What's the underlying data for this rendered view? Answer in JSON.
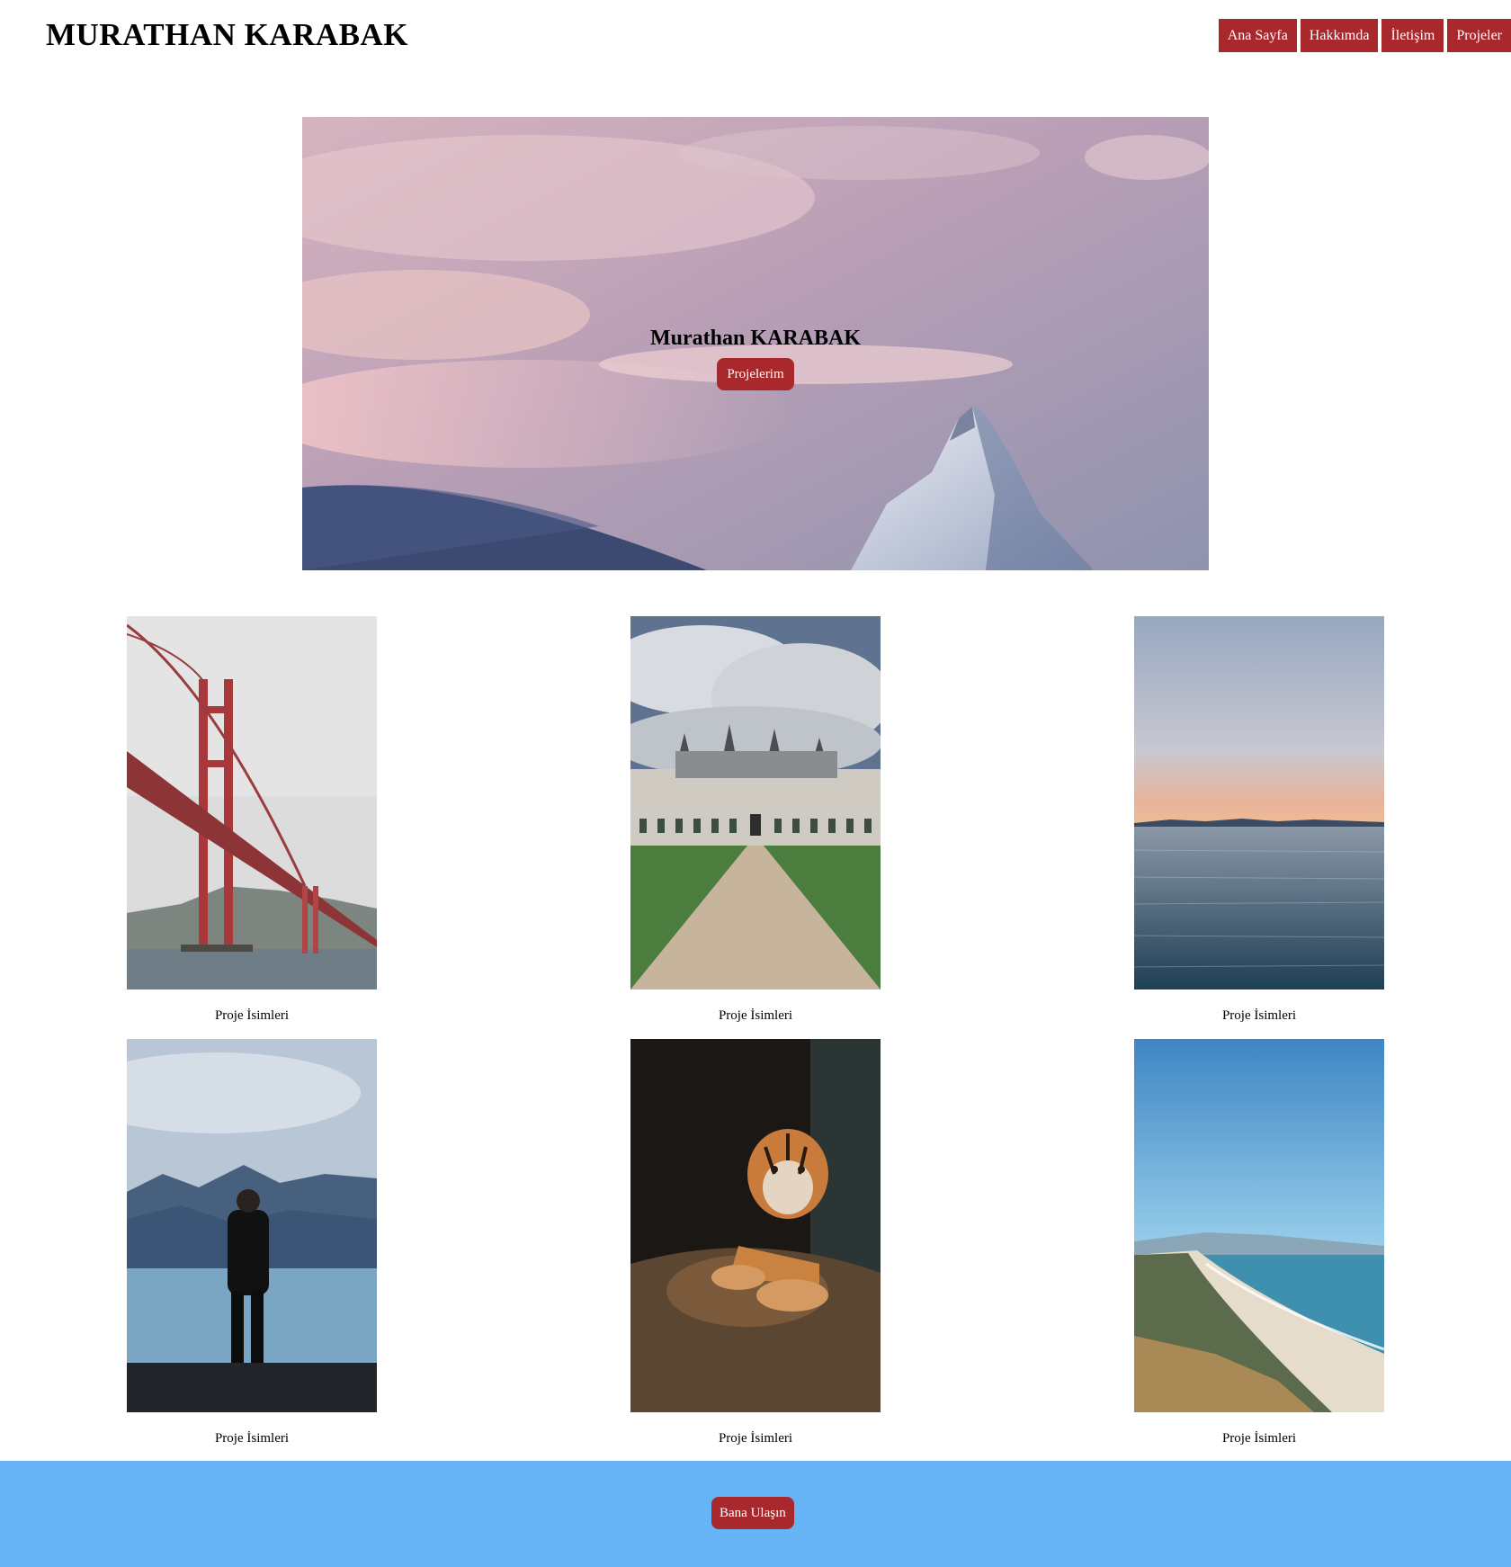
{
  "header": {
    "title": "MURATHAN KARABAK",
    "nav": [
      "Ana Sayfa",
      "Hakkımda",
      "İletişim",
      "Projeler"
    ]
  },
  "hero": {
    "title": "Murathan KARABAK",
    "button": "Projelerim"
  },
  "projects": [
    {
      "caption": "Proje İsimleri",
      "image": "golden-gate-bridge"
    },
    {
      "caption": "Proje İsimleri",
      "image": "chateau"
    },
    {
      "caption": "Proje İsimleri",
      "image": "sea-horizon"
    },
    {
      "caption": "Proje İsimleri",
      "image": "man-by-lake"
    },
    {
      "caption": "Proje İsimleri",
      "image": "tiger-cub"
    },
    {
      "caption": "Proje İsimleri",
      "image": "coastline"
    }
  ],
  "footer": {
    "button": "Bana Ulaşın"
  },
  "colors": {
    "accent": "#a8282c",
    "footer": "#66b3f5"
  }
}
